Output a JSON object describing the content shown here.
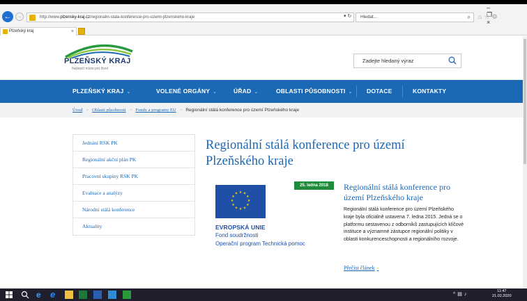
{
  "browser": {
    "url_prefix": "http://www.",
    "url_domain": "plzensky-kraj.cz",
    "url_path": "/regionalni-stala-konference-pro-uzemi-plzenskeho-kraje",
    "address_controls": "▾ ↻",
    "search_placeholder": "Hledat...",
    "tab_title": "Plzeňský kraj",
    "tab_close": "×",
    "window_controls": "– ❐ ×"
  },
  "site": {
    "logo_name": "PLZEŇSKÝ KRAJ",
    "logo_tagline": "Nejlepší místo pro život",
    "search_placeholder": "Zadejte hledaný výraz"
  },
  "nav": {
    "items": [
      {
        "label": "PLZEŇSKÝ KRAJ",
        "dropdown": true
      },
      {
        "label": "VOLENÉ ORGÁNY",
        "dropdown": true
      },
      {
        "label": "ÚŘAD",
        "dropdown": true
      },
      {
        "label": "OBLASTI PŮSOBNOSTI",
        "dropdown": true
      },
      {
        "label": "DOTACE",
        "dropdown": false
      },
      {
        "label": "KONTAKTY",
        "dropdown": false
      }
    ],
    "chevron": "⌄"
  },
  "breadcrumb": {
    "items": [
      "Úvod",
      "Oblasti působnosti",
      "Fondy a programy EU"
    ],
    "current": "Regionální stálá konference pro území Plzeňského kraje",
    "separator": ">"
  },
  "sidebar": {
    "items": [
      "Jednání RSK PK",
      "Regionální akční plán PK",
      "Pracovní skupiny RSK PK",
      "Evaluace a analýzy",
      "Národní stálá konference",
      "Aktuality"
    ]
  },
  "page": {
    "title": "Regionální stálá konference pro území Plzeňského kraje"
  },
  "article": {
    "eu_line1": "EVROPSKÁ UNIE",
    "eu_line2": "Fond soudržnosti",
    "eu_line3": "Operační program Technická pomoc",
    "date": "25. ledna 2018",
    "title": "Regionální stálá konference pro území Plzeňského kraje",
    "text": "Regionální stálá konference pro území Plzeňského kraje byla oficiálně ustavena 7. ledna 2015. Jedná se o platformu sestavenou z odborníků zastupujících klíčové instituce a významné zástupce regionální politiky v oblasti konkurenceschopnosti a regionálního rozvoje.",
    "read_more": "Přečíst článek",
    "read_more_arrow": "›"
  },
  "taskbar": {
    "time": "11:47",
    "date": "21.02.2020"
  },
  "colors": {
    "primary_blue": "#1b68b4",
    "eu_blue": "#1f4fa6",
    "date_green": "#1e8c3a",
    "eu_star": "#f4d400"
  }
}
